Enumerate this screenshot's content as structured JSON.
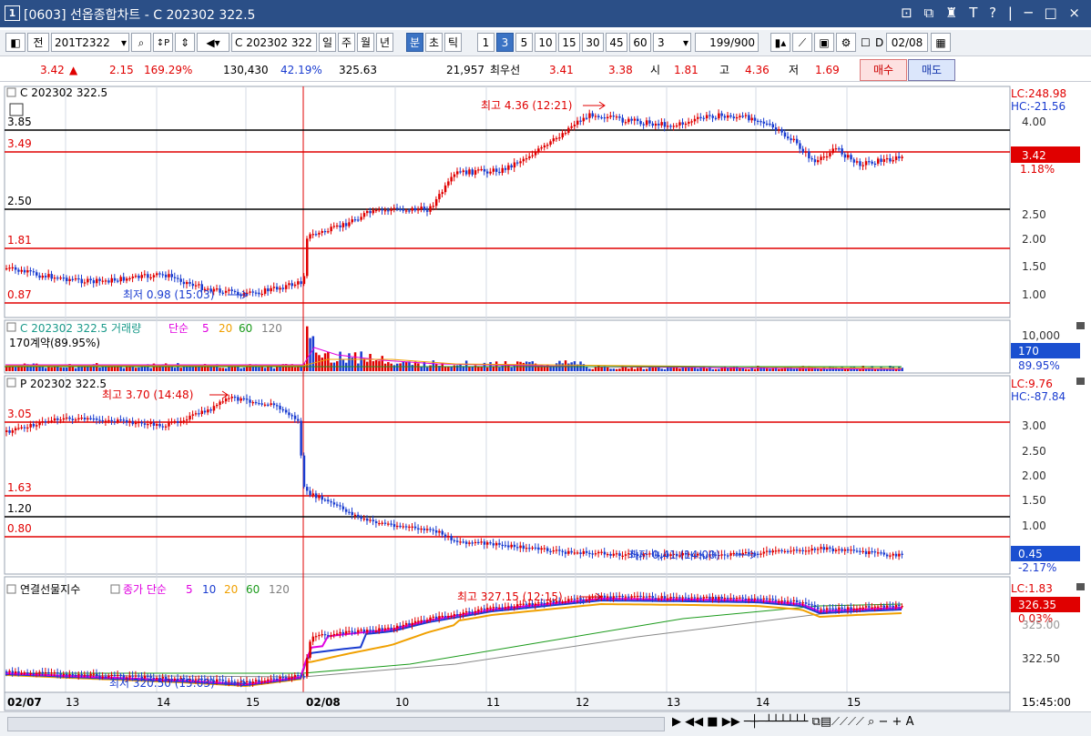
{
  "window": {
    "title": "[0603] 선옵종합차트 - C 202302 322.5",
    "index": "1",
    "controls": "⊡ ⧉ ♜ T ? | ─ □ ×"
  },
  "toolbar": {
    "prev_label": "전",
    "code": "201T2322",
    "contract": "C 202302 322",
    "periods": [
      "일",
      "주",
      "월",
      "년",
      "분",
      "초",
      "틱"
    ],
    "intervals": [
      "1",
      "3",
      "5",
      "10",
      "15",
      "30",
      "45",
      "60"
    ],
    "selected_period": "분",
    "selected_interval": "3",
    "interval_value": "3",
    "count": "199",
    "count_max": "/900",
    "date_label": "D",
    "date_value": "02/08"
  },
  "quote": {
    "price": "3.42",
    "arrow": "▲",
    "change": "2.15",
    "change_pct": "169.29%",
    "volume": "130,430",
    "volume_pct": "42.19%",
    "strike": "325.63",
    "best_qty": "21,957",
    "best_label": "최우선",
    "bid": "3.41",
    "ask": "3.38",
    "open_label": "시",
    "open": "1.81",
    "high_label": "고",
    "high": "4.36",
    "low_label": "저",
    "low": "1.69",
    "buy_label": "매수",
    "sell_label": "매도"
  },
  "panels": {
    "call": {
      "title": "C 202302 322.5",
      "lc": "LC:248.98",
      "hc": "HC:-21.56",
      "price_tag": "3.42",
      "pct_tag": "1.18%",
      "levels": [
        "3.85",
        "3.49",
        "2.50",
        "1.81",
        "0.87"
      ],
      "axis": [
        "4.00",
        "3.50",
        "3.00",
        "2.50",
        "2.00",
        "1.50",
        "1.00"
      ],
      "high_note": "최고 4.36 (12:21)",
      "low_note": "최저 0.98 (15:03)"
    },
    "volume": {
      "title": "C 202302 322.5 거래량",
      "ma_label": "단순",
      "ma": [
        "5",
        "20",
        "60",
        "120"
      ],
      "sub": "170계약(89.95%)",
      "axis": [
        "10,000"
      ],
      "tag": "170",
      "tag_pct": "89.95%"
    },
    "put": {
      "title": "P 202302 322.5",
      "lc": "LC:9.76",
      "hc": "HC:-87.84",
      "price_tag": "0.45",
      "pct_tag": "-2.17%",
      "levels": [
        "3.05",
        "1.63",
        "1.20",
        "0.80"
      ],
      "axis": [
        "3.00",
        "2.50",
        "2.00",
        "1.50",
        "1.00"
      ],
      "high_note": "최고 3.70 (14:48)",
      "low_note": "최저 0.41 (14:00)"
    },
    "futures": {
      "title": "연결선물지수",
      "ma_title": "종가 단순",
      "ma": [
        "5",
        "10",
        "20",
        "60",
        "120"
      ],
      "lc": "LC:1.83",
      "price_tag": "326.35",
      "pct_tag": "0.03%",
      "axis": [
        "322.50"
      ],
      "axis_partial": "325.00",
      "high_note": "최고 327.15 (12:15)",
      "low_note": "최저 320.50 (15:03)"
    }
  },
  "time_axis": [
    "02/07",
    "13",
    "14",
    "15",
    "02/08",
    "10",
    "11",
    "12",
    "13",
    "14",
    "15"
  ],
  "time_corner": "15:45:00",
  "colors": {
    "up": "#e00000",
    "down": "#1a3cd0",
    "ma5": "#e000e0",
    "ma10": "#1a3cd0",
    "ma20": "#f0a000",
    "ma60": "#1a9a1a",
    "ma120": "#808080"
  }
}
